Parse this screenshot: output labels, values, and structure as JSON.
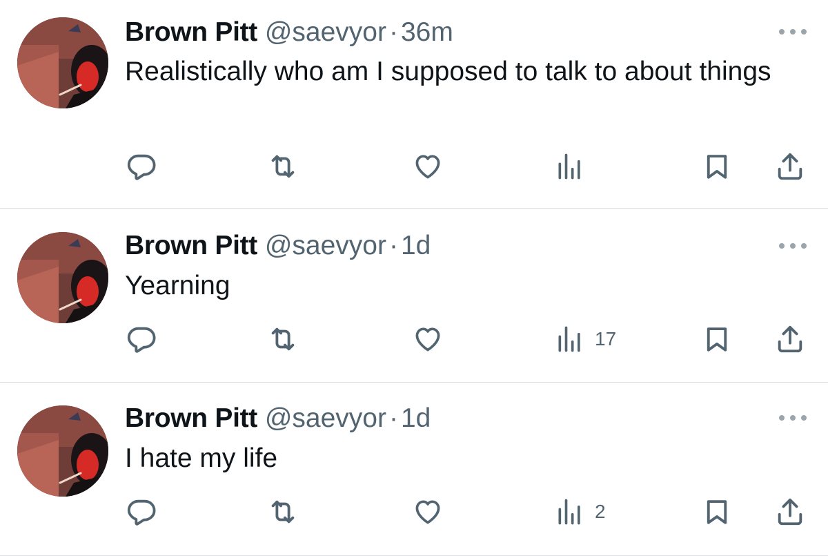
{
  "tweets": [
    {
      "name": "Brown Pitt",
      "handle": "@saevyor",
      "separator": "·",
      "time": "36m",
      "text": "Realistically who am I supposed to talk to about things",
      "views": ""
    },
    {
      "name": "Brown Pitt",
      "handle": "@saevyor",
      "separator": "·",
      "time": "1d",
      "text": "Yearning",
      "views": "17"
    },
    {
      "name": "Brown Pitt",
      "handle": "@saevyor",
      "separator": "·",
      "time": "1d",
      "text": "I hate my life",
      "views": "2"
    }
  ],
  "icons": {
    "reply": "reply-icon",
    "retweet": "retweet-icon",
    "like": "heart-icon",
    "views": "views-icon",
    "bookmark": "bookmark-icon",
    "share": "share-icon",
    "more": "more-icon"
  },
  "colors": {
    "text": "#0f1419",
    "secondary": "#536471",
    "divider": "#dcdfe3",
    "background": "#ffffff"
  }
}
